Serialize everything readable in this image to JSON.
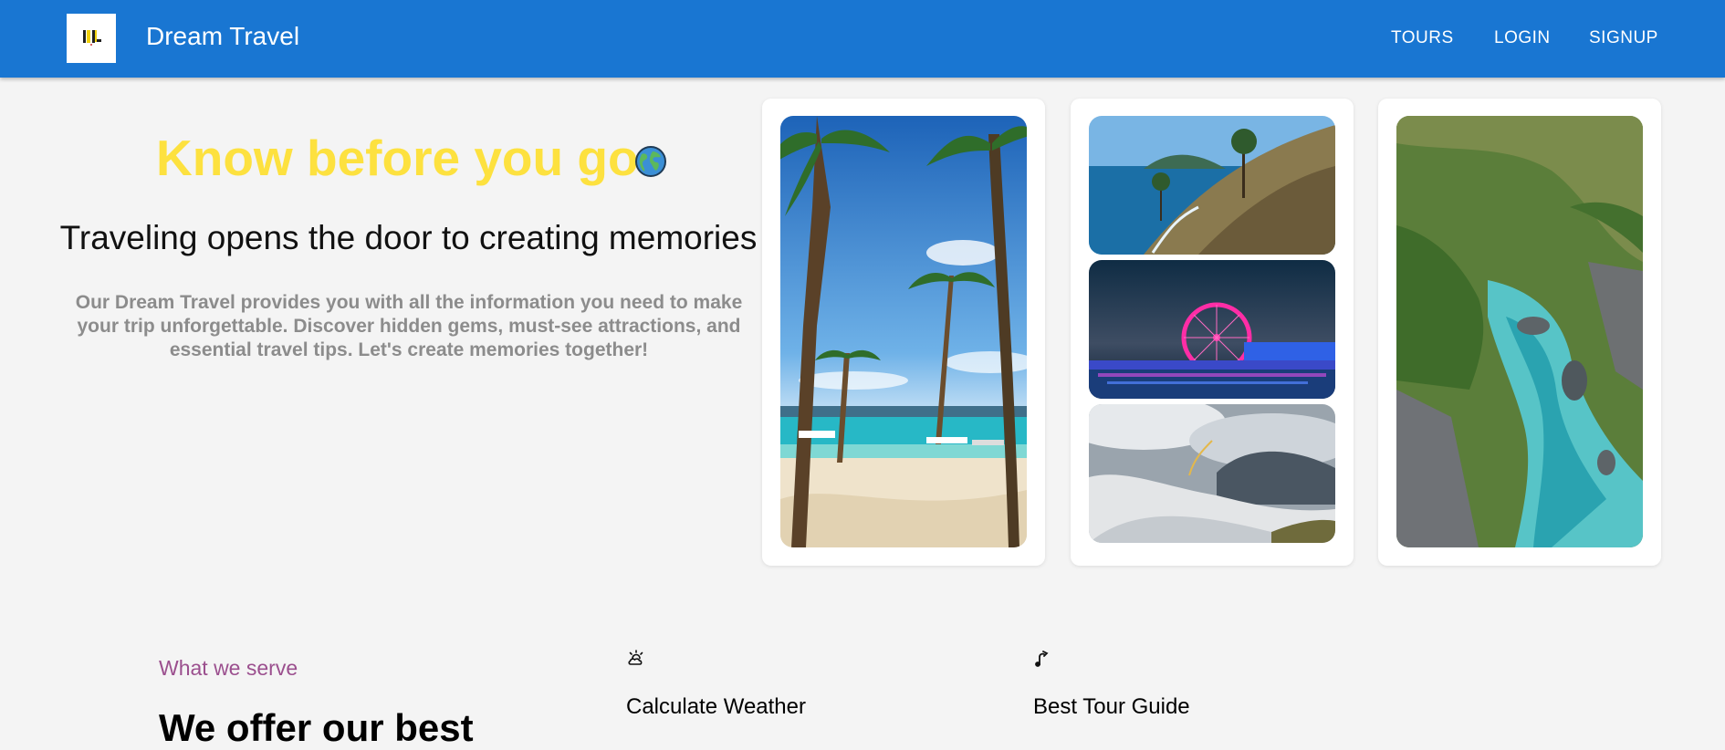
{
  "header": {
    "brand": "Dream Travel",
    "logo_icon": "brand-logo-icon",
    "nav": [
      {
        "label": "TOURS"
      },
      {
        "label": "LOGIN"
      },
      {
        "label": "SIGNUP"
      }
    ],
    "bar_color": "#1976d2"
  },
  "hero": {
    "title": "Know before you go",
    "title_icon": "globe-icon",
    "title_color": "#fde13f",
    "subtitle": "Traveling opens the door to creating memories",
    "description": "Our Dream Travel provides you with all the information you need to make your trip unforgettable. Discover hidden gems, must-see attractions, and essential travel tips. Let's create memories together!"
  },
  "gallery": {
    "images": [
      {
        "name": "beach-palm-photo"
      },
      {
        "name": "coastal-hill-photo"
      },
      {
        "name": "ferris-wheel-night-photo"
      },
      {
        "name": "cloudy-mountains-photo"
      },
      {
        "name": "lagoon-aerial-photo"
      }
    ]
  },
  "services": {
    "eyebrow": "What we serve",
    "title": "We offer our best",
    "items": [
      {
        "icon": "weather-icon",
        "title": "Calculate Weather"
      },
      {
        "icon": "route-icon",
        "title": "Best Tour Guide"
      }
    ]
  }
}
